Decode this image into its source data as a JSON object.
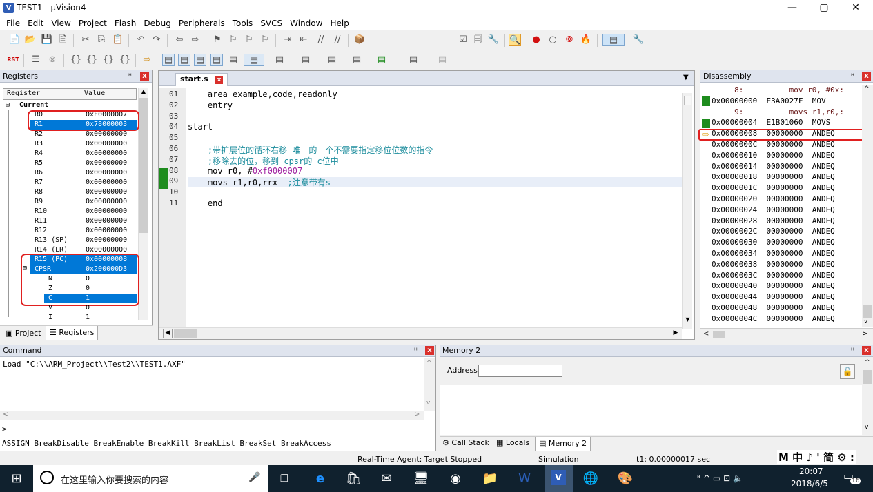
{
  "window": {
    "title": "TEST1 - µVision4",
    "icon": "V",
    "min": "—",
    "max": "▢",
    "close": "✕"
  },
  "menu": [
    "File",
    "Edit",
    "View",
    "Project",
    "Flash",
    "Debug",
    "Peripherals",
    "Tools",
    "SVCS",
    "Window",
    "Help"
  ],
  "toolbar1": [
    "📄",
    "📂",
    "💾",
    "🗎",
    "✂",
    "⎘",
    "📋",
    "↶",
    "↷",
    "⇦",
    "⇨",
    "⚑",
    "⚐",
    "⚐",
    "⚐",
    "⇥",
    "⇤",
    "//",
    "//",
    "📦"
  ],
  "toolbar1_right": [
    "☑",
    "🗐",
    "🔧",
    "🔍",
    "●",
    "○",
    "⦾",
    "🔥",
    "▤",
    "🔧"
  ],
  "toolbar2": [
    "RST",
    "☰",
    "⊗",
    "{}",
    "{}",
    "{}",
    "{}",
    "⇨",
    "▤",
    "▤",
    "▤",
    "▤",
    "▤",
    "▤",
    "▤",
    "▤",
    "▤",
    "▤",
    "▤",
    "▤",
    "▤"
  ],
  "registers": {
    "title": "Registers",
    "pin": "ᴴ",
    "close": "x",
    "col_register": "Register",
    "col_value": "Value",
    "group": "Current",
    "rows": [
      {
        "name": "R0",
        "value": "0xF0000007"
      },
      {
        "name": "R1",
        "value": "0x78000003"
      },
      {
        "name": "R2",
        "value": "0x00000000"
      },
      {
        "name": "R3",
        "value": "0x00000000"
      },
      {
        "name": "R4",
        "value": "0x00000000"
      },
      {
        "name": "R5",
        "value": "0x00000000"
      },
      {
        "name": "R6",
        "value": "0x00000000"
      },
      {
        "name": "R7",
        "value": "0x00000000"
      },
      {
        "name": "R8",
        "value": "0x00000000"
      },
      {
        "name": "R9",
        "value": "0x00000000"
      },
      {
        "name": "R10",
        "value": "0x00000000"
      },
      {
        "name": "R11",
        "value": "0x00000000"
      },
      {
        "name": "R12",
        "value": "0x00000000"
      },
      {
        "name": "R13 (SP)",
        "value": "0x00000000"
      },
      {
        "name": "R14 (LR)",
        "value": "0x00000000"
      },
      {
        "name": "R15 (PC)",
        "value": "0x00000008"
      },
      {
        "name": "CPSR",
        "value": "0x200000D3"
      },
      {
        "name": "N",
        "value": "0"
      },
      {
        "name": "Z",
        "value": "0"
      },
      {
        "name": "C",
        "value": "1"
      },
      {
        "name": "V",
        "value": "0"
      },
      {
        "name": "I",
        "value": "1"
      }
    ],
    "tab_project": "Project",
    "tab_registers": "Registers"
  },
  "editor": {
    "tab": "start.s",
    "lines": [
      {
        "no": "01",
        "text": "    area example,code,readonly"
      },
      {
        "no": "02",
        "text": "    entry"
      },
      {
        "no": "03",
        "text": ""
      },
      {
        "no": "04",
        "text": "start"
      },
      {
        "no": "05",
        "text": ""
      },
      {
        "no": "06",
        "text": "    ;带扩展位的循环右移 唯一的一个不需要指定移位位数的指令"
      },
      {
        "no": "07",
        "text": "    ;移除去的位，移到 cpsr的 c位中"
      },
      {
        "no": "08",
        "pre": "    mov r0, #",
        "num": "0xf0000007"
      },
      {
        "no": "09",
        "pre": "    movs r1,r0,rrx  ",
        "cmt": ";注意带有s"
      },
      {
        "no": "10",
        "text": ""
      },
      {
        "no": "11",
        "text": "    end"
      }
    ]
  },
  "disassembly": {
    "title": "Disassembly",
    "rows": [
      "     8:          mov r0, #0x:",
      "0x00000000  E3A0027F  MOV",
      "     9:          movs r1,r0,:",
      "0x00000004  E1B01060  MOVS",
      "0x00000008  00000000  ANDEQ",
      "0x0000000C  00000000  ANDEQ",
      "0x00000010  00000000  ANDEQ",
      "0x00000014  00000000  ANDEQ",
      "0x00000018  00000000  ANDEQ",
      "0x0000001C  00000000  ANDEQ",
      "0x00000020  00000000  ANDEQ",
      "0x00000024  00000000  ANDEQ",
      "0x00000028  00000000  ANDEQ",
      "0x0000002C  00000000  ANDEQ",
      "0x00000030  00000000  ANDEQ",
      "0x00000034  00000000  ANDEQ",
      "0x00000038  00000000  ANDEQ",
      "0x0000003C  00000000  ANDEQ",
      "0x00000040  00000000  ANDEQ",
      "0x00000044  00000000  ANDEQ",
      "0x00000048  00000000  ANDEQ",
      "0x0000004C  00000000  ANDEQ"
    ]
  },
  "command": {
    "title": "Command",
    "output": "Load \"C:\\\\ARM_Project\\\\Test2\\\\TEST1.AXF\"",
    "prompt": ">",
    "hint": "ASSIGN BreakDisable BreakEnable BreakKill BreakList BreakSet BreakAccess"
  },
  "memory": {
    "title": "Memory 2",
    "address_label": "Address:",
    "address_value": "",
    "tab_callstack": "Call Stack",
    "tab_locals": "Locals",
    "tab_memory": "Memory 2"
  },
  "status": {
    "agent": "Real-Time Agent: Target Stopped",
    "mode": "Simulation",
    "time": "t1: 0.00000017 sec",
    "ime": "M 中 ♪ ' 简 ⚙ :"
  },
  "taskbar": {
    "search_placeholder": "在这里输入你要搜索的内容",
    "time": "20:07",
    "date": "2018/6/5",
    "notification_count": "16",
    "tray": "ᴿ ^ ▭ ⊡ 🔈"
  }
}
